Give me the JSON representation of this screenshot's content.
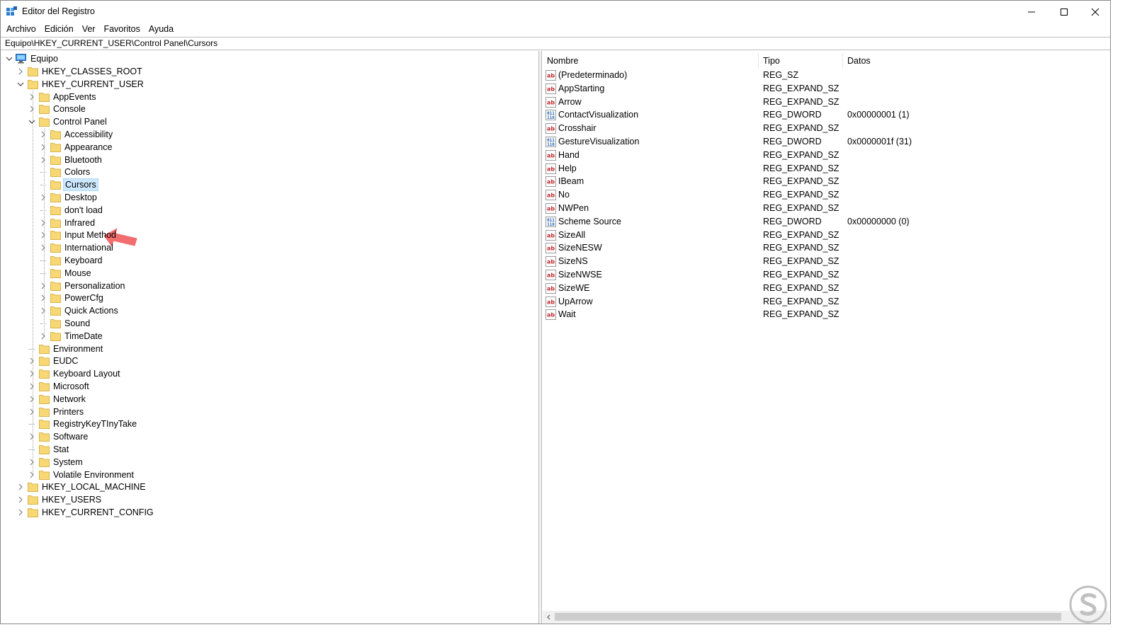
{
  "window": {
    "title": "Editor del Registro",
    "controls": {
      "minimize": "minimize-icon",
      "maximize": "maximize-icon",
      "close": "close-icon"
    }
  },
  "menu": [
    "Archivo",
    "Edición",
    "Ver",
    "Favoritos",
    "Ayuda"
  ],
  "address": "Equipo\\HKEY_CURRENT_USER\\Control Panel\\Cursors",
  "tree": {
    "root": "Equipo",
    "nodes": [
      {
        "label": "HKEY_CLASSES_ROOT",
        "depth": 1,
        "expander": "collapsed"
      },
      {
        "label": "HKEY_CURRENT_USER",
        "depth": 1,
        "expander": "expanded"
      },
      {
        "label": "AppEvents",
        "depth": 2,
        "expander": "collapsed"
      },
      {
        "label": "Console",
        "depth": 2,
        "expander": "collapsed"
      },
      {
        "label": "Control Panel",
        "depth": 2,
        "expander": "expanded"
      },
      {
        "label": "Accessibility",
        "depth": 3,
        "expander": "collapsed"
      },
      {
        "label": "Appearance",
        "depth": 3,
        "expander": "collapsed"
      },
      {
        "label": "Bluetooth",
        "depth": 3,
        "expander": "collapsed"
      },
      {
        "label": "Colors",
        "depth": 3,
        "expander": "none"
      },
      {
        "label": "Cursors",
        "depth": 3,
        "expander": "none",
        "selected": true
      },
      {
        "label": "Desktop",
        "depth": 3,
        "expander": "collapsed"
      },
      {
        "label": "don't load",
        "depth": 3,
        "expander": "none"
      },
      {
        "label": "Infrared",
        "depth": 3,
        "expander": "collapsed"
      },
      {
        "label": "Input Method",
        "depth": 3,
        "expander": "collapsed"
      },
      {
        "label": "International",
        "depth": 3,
        "expander": "collapsed"
      },
      {
        "label": "Keyboard",
        "depth": 3,
        "expander": "none"
      },
      {
        "label": "Mouse",
        "depth": 3,
        "expander": "none"
      },
      {
        "label": "Personalization",
        "depth": 3,
        "expander": "collapsed"
      },
      {
        "label": "PowerCfg",
        "depth": 3,
        "expander": "collapsed"
      },
      {
        "label": "Quick Actions",
        "depth": 3,
        "expander": "collapsed"
      },
      {
        "label": "Sound",
        "depth": 3,
        "expander": "none"
      },
      {
        "label": "TimeDate",
        "depth": 3,
        "expander": "collapsed"
      },
      {
        "label": "Environment",
        "depth": 2,
        "expander": "none"
      },
      {
        "label": "EUDC",
        "depth": 2,
        "expander": "collapsed"
      },
      {
        "label": "Keyboard Layout",
        "depth": 2,
        "expander": "collapsed"
      },
      {
        "label": "Microsoft",
        "depth": 2,
        "expander": "collapsed"
      },
      {
        "label": "Network",
        "depth": 2,
        "expander": "collapsed"
      },
      {
        "label": "Printers",
        "depth": 2,
        "expander": "collapsed"
      },
      {
        "label": "RegistryKeyTInyTake",
        "depth": 2,
        "expander": "none"
      },
      {
        "label": "Software",
        "depth": 2,
        "expander": "collapsed"
      },
      {
        "label": "Stat",
        "depth": 2,
        "expander": "none"
      },
      {
        "label": "System",
        "depth": 2,
        "expander": "collapsed"
      },
      {
        "label": "Volatile Environment",
        "depth": 2,
        "expander": "collapsed"
      },
      {
        "label": "HKEY_LOCAL_MACHINE",
        "depth": 1,
        "expander": "collapsed"
      },
      {
        "label": "HKEY_USERS",
        "depth": 1,
        "expander": "collapsed"
      },
      {
        "label": "HKEY_CURRENT_CONFIG",
        "depth": 1,
        "expander": "collapsed"
      }
    ]
  },
  "list": {
    "columns": [
      "Nombre",
      "Tipo",
      "Datos"
    ],
    "rows": [
      {
        "name": "(Predeterminado)",
        "type": "REG_SZ",
        "data": "",
        "icon": "string-value-icon"
      },
      {
        "name": "AppStarting",
        "type": "REG_EXPAND_SZ",
        "data": "",
        "icon": "string-value-icon"
      },
      {
        "name": "Arrow",
        "type": "REG_EXPAND_SZ",
        "data": "",
        "icon": "string-value-icon"
      },
      {
        "name": "ContactVisualization",
        "type": "REG_DWORD",
        "data": "0x00000001 (1)",
        "icon": "binary-value-icon"
      },
      {
        "name": "Crosshair",
        "type": "REG_EXPAND_SZ",
        "data": "",
        "icon": "string-value-icon"
      },
      {
        "name": "GestureVisualization",
        "type": "REG_DWORD",
        "data": "0x0000001f (31)",
        "icon": "binary-value-icon"
      },
      {
        "name": "Hand",
        "type": "REG_EXPAND_SZ",
        "data": "",
        "icon": "string-value-icon"
      },
      {
        "name": "Help",
        "type": "REG_EXPAND_SZ",
        "data": "",
        "icon": "string-value-icon"
      },
      {
        "name": "IBeam",
        "type": "REG_EXPAND_SZ",
        "data": "",
        "icon": "string-value-icon"
      },
      {
        "name": "No",
        "type": "REG_EXPAND_SZ",
        "data": "",
        "icon": "string-value-icon"
      },
      {
        "name": "NWPen",
        "type": "REG_EXPAND_SZ",
        "data": "",
        "icon": "string-value-icon"
      },
      {
        "name": "Scheme Source",
        "type": "REG_DWORD",
        "data": "0x00000000 (0)",
        "icon": "binary-value-icon"
      },
      {
        "name": "SizeAll",
        "type": "REG_EXPAND_SZ",
        "data": "",
        "icon": "string-value-icon"
      },
      {
        "name": "SizeNESW",
        "type": "REG_EXPAND_SZ",
        "data": "",
        "icon": "string-value-icon"
      },
      {
        "name": "SizeNS",
        "type": "REG_EXPAND_SZ",
        "data": "",
        "icon": "string-value-icon"
      },
      {
        "name": "SizeNWSE",
        "type": "REG_EXPAND_SZ",
        "data": "",
        "icon": "string-value-icon"
      },
      {
        "name": "SizeWE",
        "type": "REG_EXPAND_SZ",
        "data": "",
        "icon": "string-value-icon"
      },
      {
        "name": "UpArrow",
        "type": "REG_EXPAND_SZ",
        "data": "",
        "icon": "string-value-icon"
      },
      {
        "name": "Wait",
        "type": "REG_EXPAND_SZ",
        "data": "",
        "icon": "string-value-icon"
      }
    ]
  },
  "colors": {
    "selection": "#cce8ff",
    "folder": "#f8d775",
    "annotation_arrow": "#f26d6d",
    "icon_red": "#c4262e",
    "icon_blue": "#1f5fb0"
  }
}
